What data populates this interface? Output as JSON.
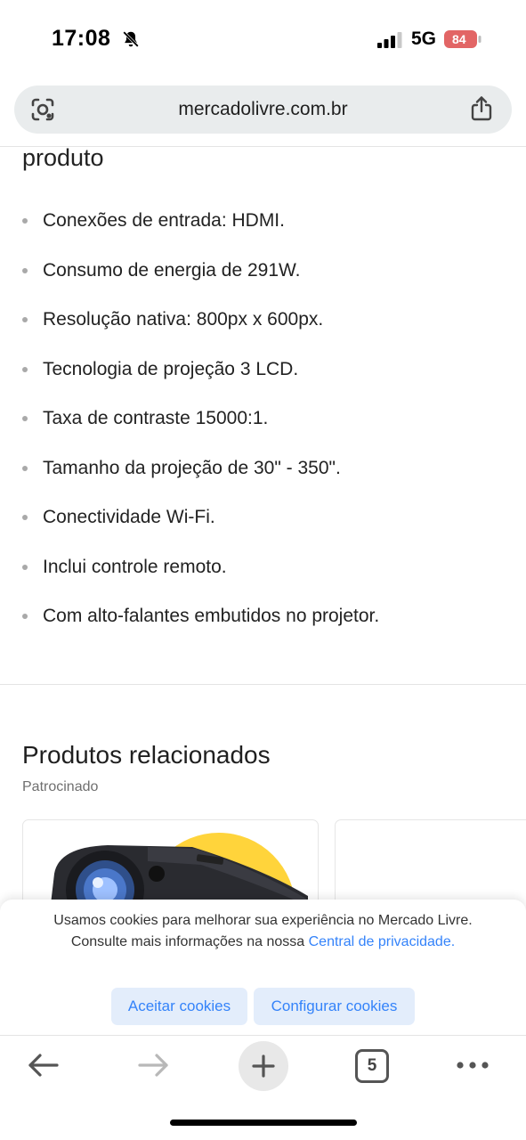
{
  "status_bar": {
    "time": "17:08",
    "network": "5G",
    "battery_level": "84",
    "icons": [
      "bell-muted-icon",
      "signal-icon",
      "battery-icon"
    ]
  },
  "browser": {
    "url": "mercadolivre.com.br",
    "icons": [
      "lens-icon",
      "share-icon"
    ]
  },
  "section": {
    "title_fragment": "produto"
  },
  "features": [
    "Conexões de entrada: HDMI.",
    "Consumo de energia de 291W.",
    "Resolução nativa: 800px x 600px.",
    "Tecnologia de projeção 3 LCD.",
    "Taxa de contraste 15000:1.",
    "Tamanho da projeção de 30\" - 350\".",
    "Conectividade Wi-Fi.",
    "Inclui controle remoto.",
    "Com alto-falantes embutidos no projetor."
  ],
  "related": {
    "title": "Produtos relacionados",
    "sponsored_label": "Patrocinado"
  },
  "cookie_banner": {
    "text": "Usamos cookies para melhorar sua experiência no Mercado Livre. Consulte mais informações na nossa ",
    "link_text": "Central de privacidade",
    "text_end": ".",
    "accept_label": "Aceitar cookies",
    "configure_label": "Configurar cookies"
  },
  "toolbar": {
    "tab_count": "5",
    "icons": [
      "back-arrow-icon",
      "forward-arrow-icon",
      "plus-icon",
      "tabs-icon",
      "more-icon"
    ]
  },
  "colors": {
    "accent": "#3483fa",
    "accent_bg": "#e3edfb",
    "url_bar_bg": "#e9eced",
    "product_yellow": "#ffd43b"
  }
}
